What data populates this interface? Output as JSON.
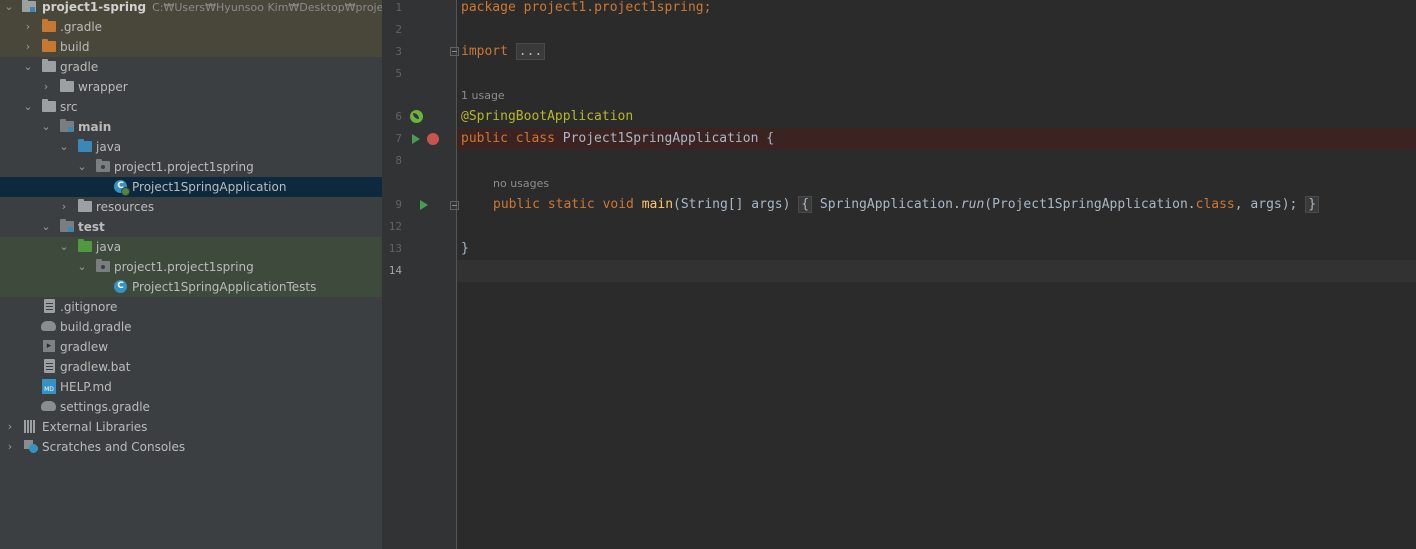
{
  "project_tree": {
    "root": {
      "name": "project1-spring",
      "path": "C:₩Users₩Hyunsoo Kim₩Desktop₩project1-s"
    },
    "items": [
      {
        "label": ".gradle"
      },
      {
        "label": "build"
      },
      {
        "label": "gradle"
      },
      {
        "label": "wrapper"
      },
      {
        "label": "src"
      },
      {
        "label": "main"
      },
      {
        "label": "java"
      },
      {
        "label": "project1.project1spring"
      },
      {
        "label": "Project1SpringApplication"
      },
      {
        "label": "resources"
      },
      {
        "label": "test"
      },
      {
        "label": "java"
      },
      {
        "label": "project1.project1spring"
      },
      {
        "label": "Project1SpringApplicationTests"
      },
      {
        "label": ".gitignore"
      },
      {
        "label": "build.gradle"
      },
      {
        "label": "gradlew"
      },
      {
        "label": "gradlew.bat"
      },
      {
        "label": "HELP.md"
      },
      {
        "label": "settings.gradle"
      },
      {
        "label": "External Libraries"
      },
      {
        "label": "Scratches and Consoles"
      }
    ]
  },
  "editor": {
    "line_numbers": [
      "1",
      "2",
      "3",
      "5",
      "6",
      "7",
      "8",
      "9",
      "12",
      "13",
      "14"
    ],
    "hints": {
      "usage": "1 usage",
      "no_usages": "no usages"
    },
    "code": {
      "l1_kw": "package",
      "l1_rest": " project1.project1spring;",
      "l3_kw": "import",
      "l3_fold": "...",
      "l6_ann": "@SpringBootApplication",
      "l7_kw": "public class",
      "l7_rest": " Project1SpringApplication {",
      "l9_kw": "public static void",
      "l9_fn": "main",
      "l9_params": "(String[] args)",
      "l9_open": "{",
      "l9_call": "SpringApplication.",
      "l9_run": "run",
      "l9_args": "(Project1SpringApplication.",
      "l9_class": "class",
      "l9_end": ", args);",
      "l9_close": "}",
      "l13": "}"
    }
  },
  "colors": {
    "background": "#2b2b2b",
    "sidebar": "#3c3f41",
    "keyword": "#cc7832",
    "annotation": "#bbb529",
    "method": "#ffc66d",
    "selection": "#0d293e"
  }
}
